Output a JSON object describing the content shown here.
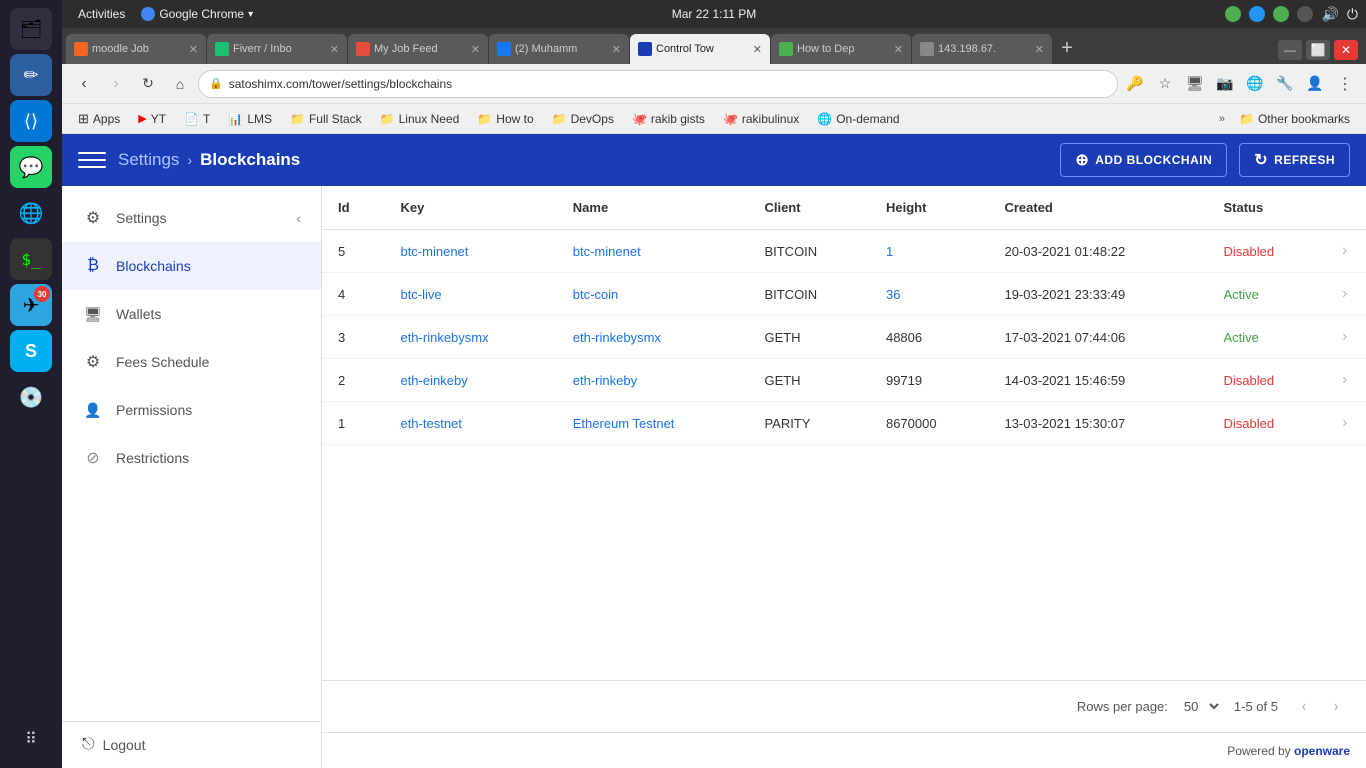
{
  "os": {
    "activities_label": "Activities",
    "app_name": "Google Chrome",
    "datetime": "Mar 22  1:11 PM"
  },
  "browser": {
    "tabs": [
      {
        "id": "moodle",
        "label": "moodle Job",
        "favicon_class": "fav-moodle",
        "active": false
      },
      {
        "id": "fiverr",
        "label": "Fiverr / Inbo",
        "favicon_class": "fav-fiverr",
        "active": false
      },
      {
        "id": "myjob",
        "label": "My Job Feed",
        "favicon_class": "fav-myjob",
        "active": false
      },
      {
        "id": "fb",
        "label": "(2) Muhamm",
        "favicon_class": "fav-fb",
        "active": false
      },
      {
        "id": "control",
        "label": "Control Tow",
        "favicon_class": "fav-control",
        "active": true
      },
      {
        "id": "howto",
        "label": "How to Dep",
        "favicon_class": "fav-howto",
        "active": false
      },
      {
        "id": "ip",
        "label": "143.198.67.",
        "favicon_class": "fav-ip",
        "active": false
      }
    ],
    "address": "satoshimx.com/tower/settings/blockchains",
    "bookmarks": [
      {
        "id": "apps",
        "label": "Apps",
        "icon": "⊞"
      },
      {
        "id": "yt",
        "label": "YT",
        "icon": "▶"
      },
      {
        "id": "t",
        "label": "T",
        "icon": "📄"
      },
      {
        "id": "lms",
        "label": "LMS",
        "icon": "📊"
      },
      {
        "id": "fullstack",
        "label": "Full Stack",
        "icon": "📁"
      },
      {
        "id": "linuxneed",
        "label": "Linux Need",
        "icon": "📁"
      },
      {
        "id": "howto",
        "label": "How to",
        "icon": "📁"
      },
      {
        "id": "devops",
        "label": "DevOps",
        "icon": "📁"
      },
      {
        "id": "rakibgists",
        "label": "rakib gists",
        "icon": "🐙"
      },
      {
        "id": "rakibulinux",
        "label": "rakibulinux",
        "icon": "🐙"
      },
      {
        "id": "ondemand",
        "label": "On-demand",
        "icon": "🌐"
      }
    ]
  },
  "header": {
    "breadcrumb_settings": "Settings",
    "breadcrumb_separator": "›",
    "breadcrumb_current": "Blockchains",
    "add_button": "ADD BLOCKCHAIN",
    "refresh_button": "REFRESH"
  },
  "sidebar": {
    "items": [
      {
        "id": "settings",
        "label": "Settings",
        "icon": "⚙",
        "active": false,
        "toggle": true
      },
      {
        "id": "blockchains",
        "label": "Blockchains",
        "icon": "₿",
        "active": true,
        "toggle": false
      },
      {
        "id": "wallets",
        "label": "Wallets",
        "icon": "🖥",
        "active": false,
        "toggle": false
      },
      {
        "id": "fees",
        "label": "Fees Schedule",
        "icon": "⚙",
        "active": false,
        "toggle": false
      },
      {
        "id": "permissions",
        "label": "Permissions",
        "icon": "👤",
        "active": false,
        "toggle": false
      },
      {
        "id": "restrictions",
        "label": "Restrictions",
        "icon": "⊘",
        "active": false,
        "toggle": false
      }
    ],
    "logout_label": "Logout"
  },
  "table": {
    "columns": [
      "Id",
      "Key",
      "Name",
      "Client",
      "Height",
      "Created",
      "Status"
    ],
    "rows": [
      {
        "id": "5",
        "key": "btc-minenet",
        "name": "btc-minenet",
        "client": "BITCOIN",
        "height": "1",
        "created": "20-03-2021 01:48:22",
        "status": "Disabled",
        "status_type": "disabled"
      },
      {
        "id": "4",
        "key": "btc-live",
        "name": "btc-coin",
        "client": "BITCOIN",
        "height": "36",
        "created": "19-03-2021 23:33:49",
        "status": "Active",
        "status_type": "active"
      },
      {
        "id": "3",
        "key": "eth-rinkebysmx",
        "name": "eth-rinkebysmx",
        "client": "GETH",
        "height": "48806",
        "created": "17-03-2021 07:44:06",
        "status": "Active",
        "status_type": "active"
      },
      {
        "id": "2",
        "key": "eth-einkeby",
        "name": "eth-rinkeby",
        "client": "GETH",
        "height": "99719",
        "created": "14-03-2021 15:46:59",
        "status": "Disabled",
        "status_type": "disabled"
      },
      {
        "id": "1",
        "key": "eth-testnet",
        "name": "Ethereum Testnet",
        "client": "PARITY",
        "height": "8670000",
        "created": "13-03-2021 15:30:07",
        "status": "Disabled",
        "status_type": "disabled"
      }
    ]
  },
  "pagination": {
    "rows_per_page_label": "Rows per page:",
    "rows_per_page_value": "50",
    "page_info": "1-5 of 5"
  },
  "footer": {
    "powered_by": "Powered by",
    "brand": "openware"
  },
  "taskbar_apps": [
    {
      "id": "files",
      "icon": "📁",
      "badge": null
    },
    {
      "id": "whatsapp",
      "icon": "💬",
      "badge": null,
      "color": "#25d366"
    },
    {
      "id": "chrome",
      "icon": "🌐",
      "badge": null
    },
    {
      "id": "terminal",
      "icon": "⬛",
      "badge": null
    },
    {
      "id": "pen",
      "icon": "✏",
      "badge": null
    },
    {
      "id": "telegram",
      "icon": "✈",
      "badge": "30",
      "color": "#2ca5e0"
    },
    {
      "id": "skype",
      "icon": "S",
      "badge": null,
      "color": "#00aff0"
    },
    {
      "id": "disk",
      "icon": "💿",
      "badge": null
    },
    {
      "id": "grid",
      "icon": "⠿",
      "badge": null
    }
  ]
}
